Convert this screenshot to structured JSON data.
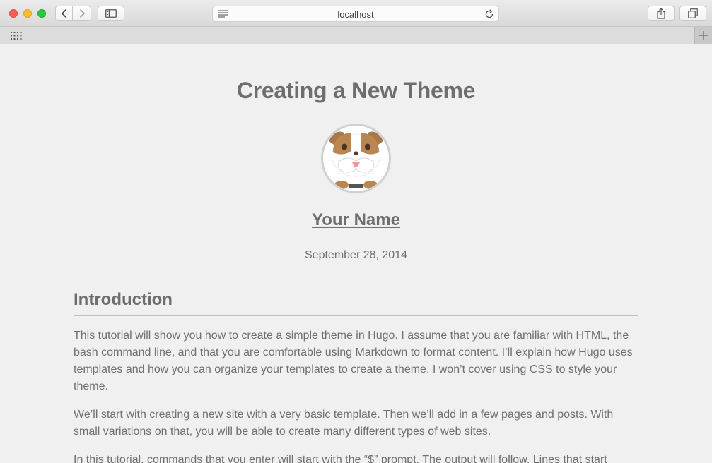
{
  "browser": {
    "url": "localhost",
    "icons": {
      "back": "chevron-left-icon",
      "forward": "chevron-right-icon",
      "sidebar": "sidebar-icon",
      "reader": "reader-icon",
      "reload": "reload-icon",
      "share": "share-icon",
      "tabs": "tabs-overview-icon",
      "favorites": "grid-icon",
      "new_tab": "plus-icon"
    }
  },
  "post": {
    "title": "Creating a New Theme",
    "author": "Your Name",
    "date": "September 28, 2014",
    "section_heading": "Introduction",
    "paragraphs": [
      "This tutorial will show you how to create a simple theme in Hugo. I assume that you are familiar with HTML, the bash command line, and that you are comfortable using Markdown to format content. I’ll explain how Hugo uses templates and how you can organize your templates to create a theme. I won’t cover using CSS to style your theme.",
      "We’ll start with creating a new site with a very basic template. Then we’ll add in a few pages and posts. With small variations on that, you will be able to create many different types of web sites.",
      "In this tutorial, commands that you enter will start with the “$” prompt. The output will follow. Lines that start"
    ]
  },
  "colors": {
    "text": "#6f6f6f",
    "page_background": "#f0f0f0",
    "traffic_close": "#fc5f57",
    "traffic_minimize": "#fdbc2e",
    "traffic_zoom": "#28c840"
  }
}
